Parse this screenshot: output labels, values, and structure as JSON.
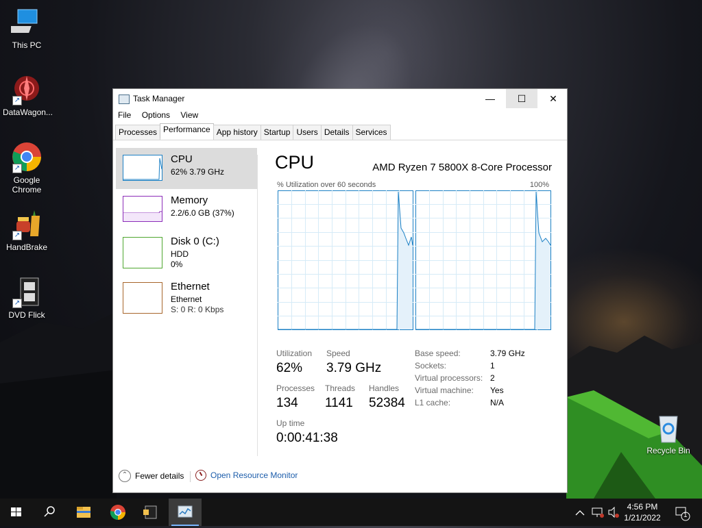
{
  "desktop": {
    "icons": [
      {
        "label": "This PC"
      },
      {
        "label": "DataWagon..."
      },
      {
        "label": "Google Chrome"
      },
      {
        "label": "HandBrake"
      },
      {
        "label": "DVD Flick"
      },
      {
        "label": "Recycle Bin"
      }
    ]
  },
  "window": {
    "title": "Task Manager",
    "menu": [
      "File",
      "Options",
      "View"
    ],
    "tabs": [
      "Processes",
      "Performance",
      "App history",
      "Startup",
      "Users",
      "Details",
      "Services"
    ],
    "active_tab": "Performance",
    "sidebar": [
      {
        "name": "CPU",
        "sub1": "62%  3.79 GHz",
        "sub2": "",
        "color": "#1a7fc4"
      },
      {
        "name": "Memory",
        "sub1": "2.2/6.0 GB (37%)",
        "sub2": "",
        "color": "#8b2bb8"
      },
      {
        "name": "Disk 0 (C:)",
        "sub1": "HDD",
        "sub2": "0%",
        "color": "#4ea72e"
      },
      {
        "name": "Ethernet",
        "sub1": "Ethernet",
        "sub2": "S: 0  R: 0 Kbps",
        "color": "#a7652a"
      }
    ],
    "main": {
      "title": "CPU",
      "processor": "AMD Ryzen 7 5800X 8-Core Processor",
      "graph_caption": "% Utilization over 60 seconds",
      "graph_max": "100%",
      "stats": {
        "utilization_label": "Utilization",
        "utilization": "62%",
        "speed_label": "Speed",
        "speed": "3.79 GHz",
        "processes_label": "Processes",
        "processes": "134",
        "threads_label": "Threads",
        "threads": "1141",
        "handles_label": "Handles",
        "handles": "52384",
        "uptime_label": "Up time",
        "uptime": "0:00:41:38"
      },
      "details": [
        {
          "k": "Base speed:",
          "v": "3.79 GHz"
        },
        {
          "k": "Sockets:",
          "v": "1"
        },
        {
          "k": "Virtual processors:",
          "v": "2"
        },
        {
          "k": "Virtual machine:",
          "v": "Yes"
        },
        {
          "k": "L1 cache:",
          "v": "N/A"
        }
      ]
    },
    "footer": {
      "fewer_details": "Fewer details",
      "open_resource_monitor": "Open Resource Monitor"
    }
  },
  "taskbar": {
    "time": "4:56 PM",
    "date": "1/21/2022",
    "notification_count": "1"
  },
  "colors": {
    "cpu_line": "#1a7fc4",
    "accent": "#1c5dab"
  }
}
